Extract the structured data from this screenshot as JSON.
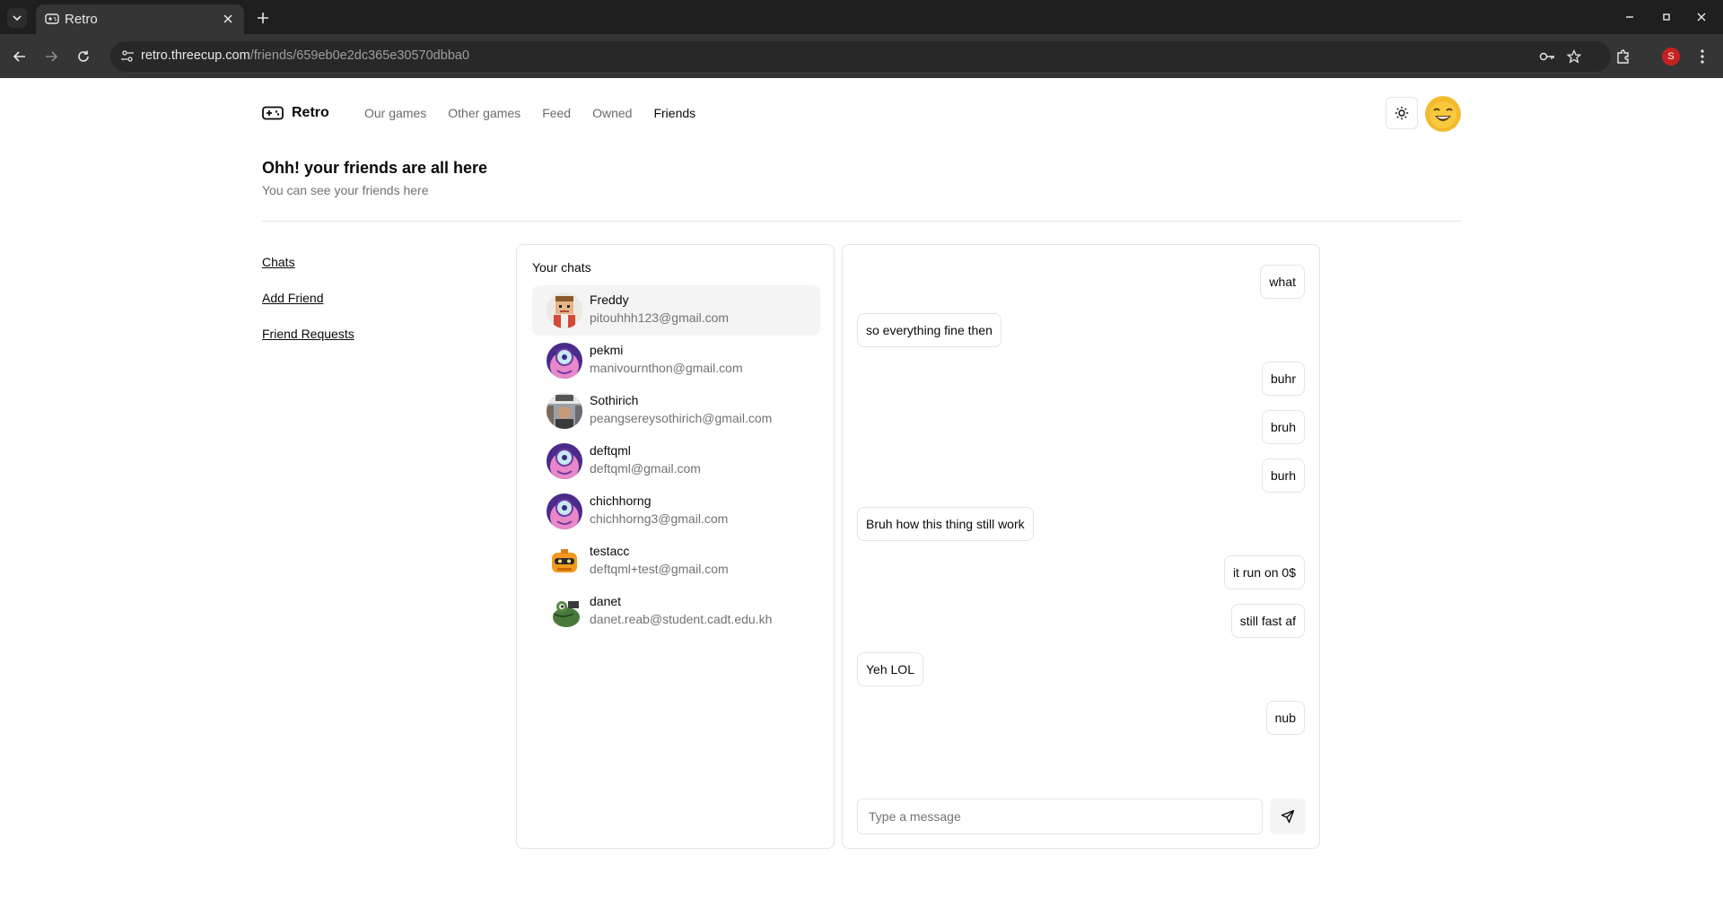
{
  "browser": {
    "tab_title": "Retro",
    "url_domain": "retro.threecup.com",
    "url_path": "/friends/659eb0e2dc365e30570dbba0",
    "profile_initial": "S"
  },
  "header": {
    "brand": "Retro",
    "nav": [
      {
        "label": "Our games"
      },
      {
        "label": "Other games"
      },
      {
        "label": "Feed"
      },
      {
        "label": "Owned"
      },
      {
        "label": "Friends",
        "active": true
      }
    ]
  },
  "page": {
    "title": "Ohh! your friends are all here",
    "subtitle": "You can see your friends here"
  },
  "sidebar": {
    "items": [
      {
        "label": "Chats"
      },
      {
        "label": "Add Friend"
      },
      {
        "label": "Friend Requests"
      }
    ]
  },
  "chats": {
    "title": "Your chats",
    "items": [
      {
        "name": "Freddy",
        "email": "pitouhhh123@gmail.com",
        "avatar": "pixel-character-avatar",
        "active": true
      },
      {
        "name": "pekmi",
        "email": "manivournthon@gmail.com",
        "avatar": "pink-character-avatar"
      },
      {
        "name": "Sothirich",
        "email": "peangsereysothirich@gmail.com",
        "avatar": "photo-avatar"
      },
      {
        "name": "deftqml",
        "email": "deftqml@gmail.com",
        "avatar": "pink-character-avatar"
      },
      {
        "name": "chichhorng",
        "email": "chichhorng3@gmail.com",
        "avatar": "pink-character-avatar"
      },
      {
        "name": "testacc",
        "email": "deftqml+test@gmail.com",
        "avatar": "orange-robot-avatar"
      },
      {
        "name": "danet",
        "email": "danet.reab@student.cadt.edu.kh",
        "avatar": "frog-avatar"
      }
    ]
  },
  "conversation": {
    "messages": [
      {
        "text": "what",
        "side": "right"
      },
      {
        "text": "so everything fine then",
        "side": "left"
      },
      {
        "text": "buhr",
        "side": "right"
      },
      {
        "text": "bruh",
        "side": "right"
      },
      {
        "text": "burh",
        "side": "right"
      },
      {
        "text": "Bruh how this thing still work",
        "side": "left"
      },
      {
        "text": "it run on 0$",
        "side": "right"
      },
      {
        "text": "still fast af",
        "side": "right"
      },
      {
        "text": "Yeh LOL",
        "side": "left"
      },
      {
        "text": "nub",
        "side": "right"
      }
    ],
    "input_placeholder": "Type a message"
  },
  "colors": {
    "border": "#e5e5e5",
    "muted_text": "#737373",
    "active_bg": "#f4f4f5",
    "user_avatar": "#f5b92e"
  }
}
